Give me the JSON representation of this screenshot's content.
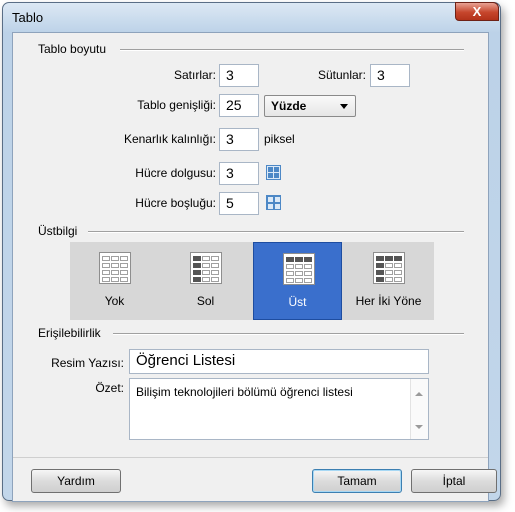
{
  "window": {
    "title": "Tablo",
    "close_glyph": "X"
  },
  "size": {
    "heading": "Tablo boyutu",
    "rows_label": "Satırlar:",
    "rows_value": "3",
    "cols_label": "Sütunlar:",
    "cols_value": "3",
    "width_label": "Tablo genişliği:",
    "width_value": "25",
    "width_unit": "Yüzde",
    "border_label": "Kenarlık kalınlığı:",
    "border_value": "3",
    "border_unit": "piksel",
    "padding_label": "Hücre dolgusu:",
    "padding_value": "3",
    "spacing_label": "Hücre boşluğu:",
    "spacing_value": "5"
  },
  "header": {
    "heading": "Üstbilgi",
    "options": [
      "Yok",
      "Sol",
      "Üst",
      "Her İki Yöne"
    ],
    "selected": "Üst"
  },
  "accessibility": {
    "heading": "Erişilebilirlik",
    "caption_label": "Resim Yazısı:",
    "caption_value": "Öğrenci Listesi",
    "summary_label": "Özet:",
    "summary_value": "Bilişim teknolojileri bölümü öğrenci listesi"
  },
  "buttons": {
    "help": "Yardım",
    "ok": "Tamam",
    "cancel": "İptal"
  },
  "colors": {
    "accent": "#3a6fcc",
    "icon_blue": "#4d88c6"
  }
}
